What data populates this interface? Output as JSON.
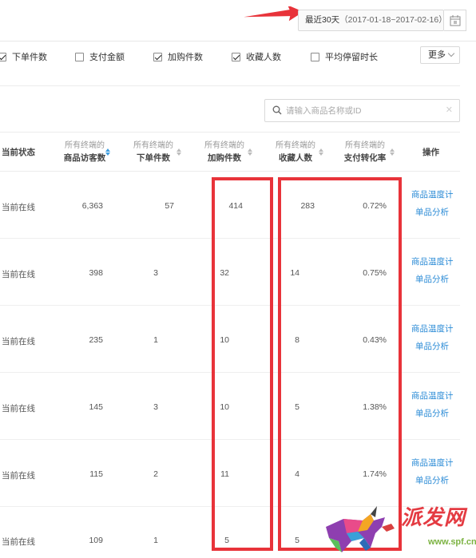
{
  "date_range": {
    "label": "最近30天",
    "range": "（2017-01-18~2017-02-16）"
  },
  "filters": [
    {
      "label": "下单件数",
      "checked": true
    },
    {
      "label": "支付金额",
      "checked": false
    },
    {
      "label": "加购件数",
      "checked": true
    },
    {
      "label": "收藏人数",
      "checked": true
    },
    {
      "label": "平均停留时长",
      "checked": false
    }
  ],
  "more_label": "更多",
  "search": {
    "placeholder": "请输入商品名称或ID",
    "clear_icon": "✕"
  },
  "table": {
    "columns": [
      {
        "name": "当前状态"
      },
      {
        "small": "所有终端的",
        "large": "商品访客数"
      },
      {
        "small": "所有终端的",
        "large": "下单件数"
      },
      {
        "small": "所有终端的",
        "large": "加购件数"
      },
      {
        "small": "所有终端的",
        "large": "收藏人数"
      },
      {
        "small": "所有终端的",
        "large": "支付转化率"
      },
      {
        "name": "操作"
      }
    ],
    "rows": [
      {
        "status": "当前在线",
        "visitors": "6,363",
        "orders": "57",
        "cart": "414",
        "favorites": "283",
        "conversion": "0.72%",
        "action1": "商品温度计",
        "action2": "单品分析"
      },
      {
        "status": "当前在线",
        "visitors": "398",
        "orders": "3",
        "cart": "32",
        "favorites": "14",
        "conversion": "0.75%",
        "action1": "商品温度计",
        "action2": "单品分析"
      },
      {
        "status": "当前在线",
        "visitors": "235",
        "orders": "1",
        "cart": "10",
        "favorites": "8",
        "conversion": "0.43%",
        "action1": "商品温度计",
        "action2": "单品分析"
      },
      {
        "status": "当前在线",
        "visitors": "145",
        "orders": "3",
        "cart": "10",
        "favorites": "5",
        "conversion": "1.38%",
        "action1": "商品温度计",
        "action2": "单品分析"
      },
      {
        "status": "当前在线",
        "visitors": "115",
        "orders": "2",
        "cart": "11",
        "favorites": "4",
        "conversion": "1.74%",
        "action1": "商品温度计",
        "action2": "单品分析"
      },
      {
        "status": "当前在线",
        "visitors": "109",
        "orders": "1",
        "cart": "5",
        "favorites": "5",
        "conversion": "",
        "action1": "",
        "action2": ""
      }
    ]
  },
  "watermark": {
    "title": "派发网",
    "url": "www.spf.cn"
  },
  "colors": {
    "annotation_red": "#e8333a",
    "link_blue": "#2b8bd6",
    "sort_active": "#3d9ddf"
  }
}
